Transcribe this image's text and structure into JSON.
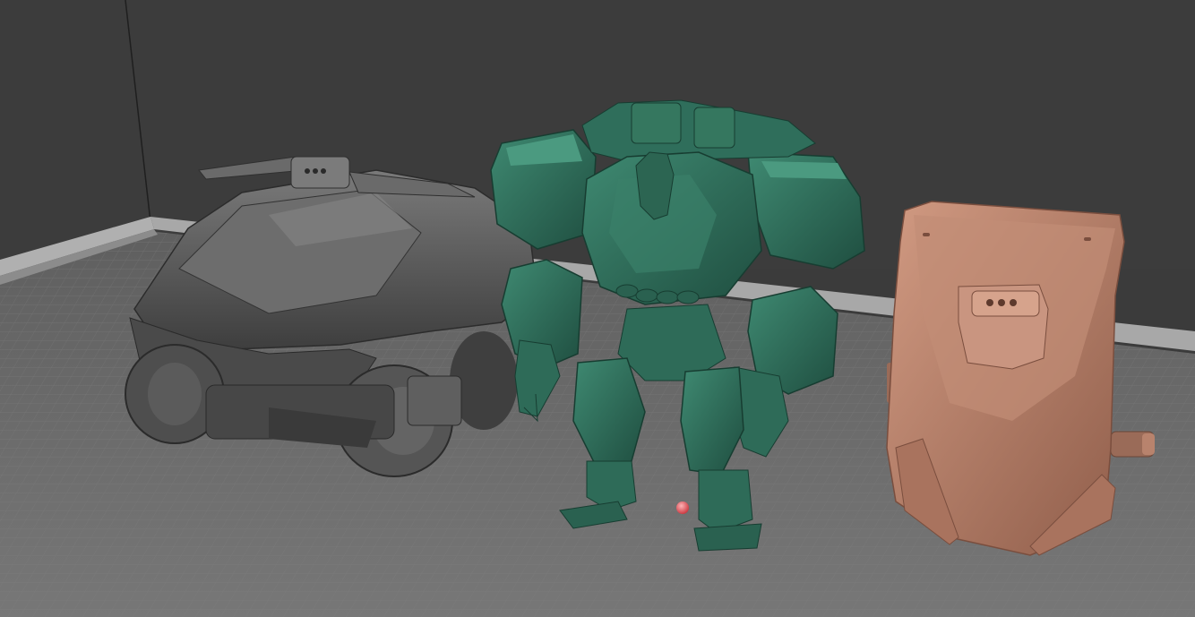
{
  "viewport": {
    "background_color": "#3b3b3b",
    "floor_color": "#6a6a6a",
    "grid_color": "#7d7d7d",
    "wall_trim_color": "#a9a9a9"
  },
  "scene_objects": [
    {
      "id": "vehicle",
      "kind": "armored buggy model",
      "color": "#5e5e5e"
    },
    {
      "id": "robot",
      "kind": "mech robot model",
      "color": "#2e6b58"
    },
    {
      "id": "pod",
      "kind": "drop pod model",
      "color": "#b27c66"
    }
  ],
  "pivot_marker": {
    "color": "#e5474f"
  }
}
